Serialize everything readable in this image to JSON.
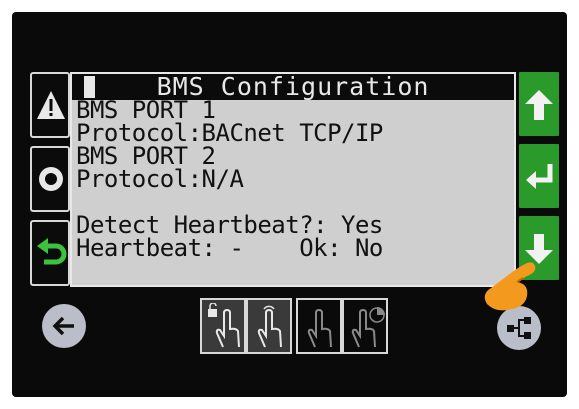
{
  "screen": {
    "title": "BMS Configuration",
    "lines": [
      "BMS PORT 1",
      "Protocol:BACnet TCP/IP",
      "BMS PORT 2",
      "Protocol:N/A",
      "",
      "Detect Heartbeat?: Yes",
      "Heartbeat: -    Ok: No"
    ]
  },
  "left_buttons": {
    "alarm": "warning-icon",
    "menu": "circle-icon",
    "escape": "undo-arrow-icon"
  },
  "right_buttons": {
    "up": "arrow-up-icon",
    "enter": "enter-icon",
    "down": "arrow-down-icon"
  },
  "bottom_buttons": {
    "back": "arrow-left-icon",
    "network": "network-icon"
  },
  "gesture_icons": [
    "unlock-tap-icon",
    "tap-icon",
    "swipe-icon",
    "pie-tap-icon"
  ],
  "colors": {
    "lcd_bg": "#cfcfcf",
    "lcd_text": "#111111",
    "title_bg": "#0b0b0b",
    "nav_green": "#2a9a2a",
    "finger_orange": "#f39a1e"
  }
}
